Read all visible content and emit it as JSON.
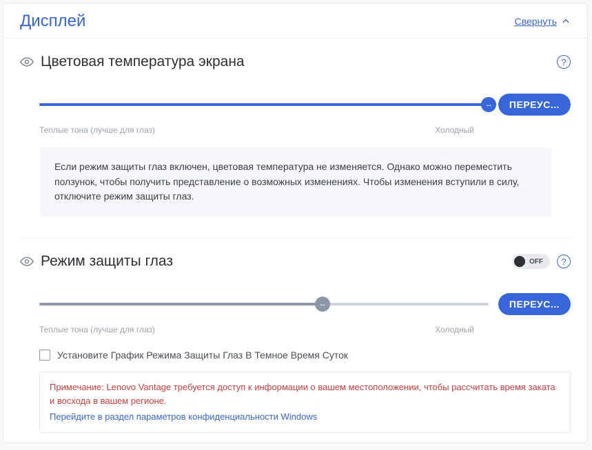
{
  "header": {
    "title": "Дисплей",
    "collapse": "Свернуть"
  },
  "section1": {
    "title": "Цветовая температура экрана",
    "warmLabel": "Теплые тона (лучше для глаз)",
    "coldLabel": "Холодный",
    "resetBtn": "ПЕРЕУС...",
    "sliderPercent": 100,
    "info": "Если режим защиты глаз включен, цветовая температура не изменяется. Однако можно переместить ползунок, чтобы получить представление о возможных изменениях. Чтобы изменения вступили в силу, отключите режим защиты глаз."
  },
  "section2": {
    "title": "Режим защиты глаз",
    "toggleState": "OFF",
    "warmLabel": "Теплые тона (лучше для глаз)",
    "coldLabel": "Холодный",
    "resetBtn": "ПЕРЕУС...",
    "sliderPercent": 63,
    "checkbox": "Установите График Режима Защиты Глаз В Темное Время Суток",
    "noteRed": "Примечание: Lenovo Vantage требуется доступ к информации о вашем местоположении, чтобы рассчитать время заката и восхода в вашем регионе.",
    "noteLink": "Перейдите в раздел параметров конфиденциальности Windows"
  }
}
